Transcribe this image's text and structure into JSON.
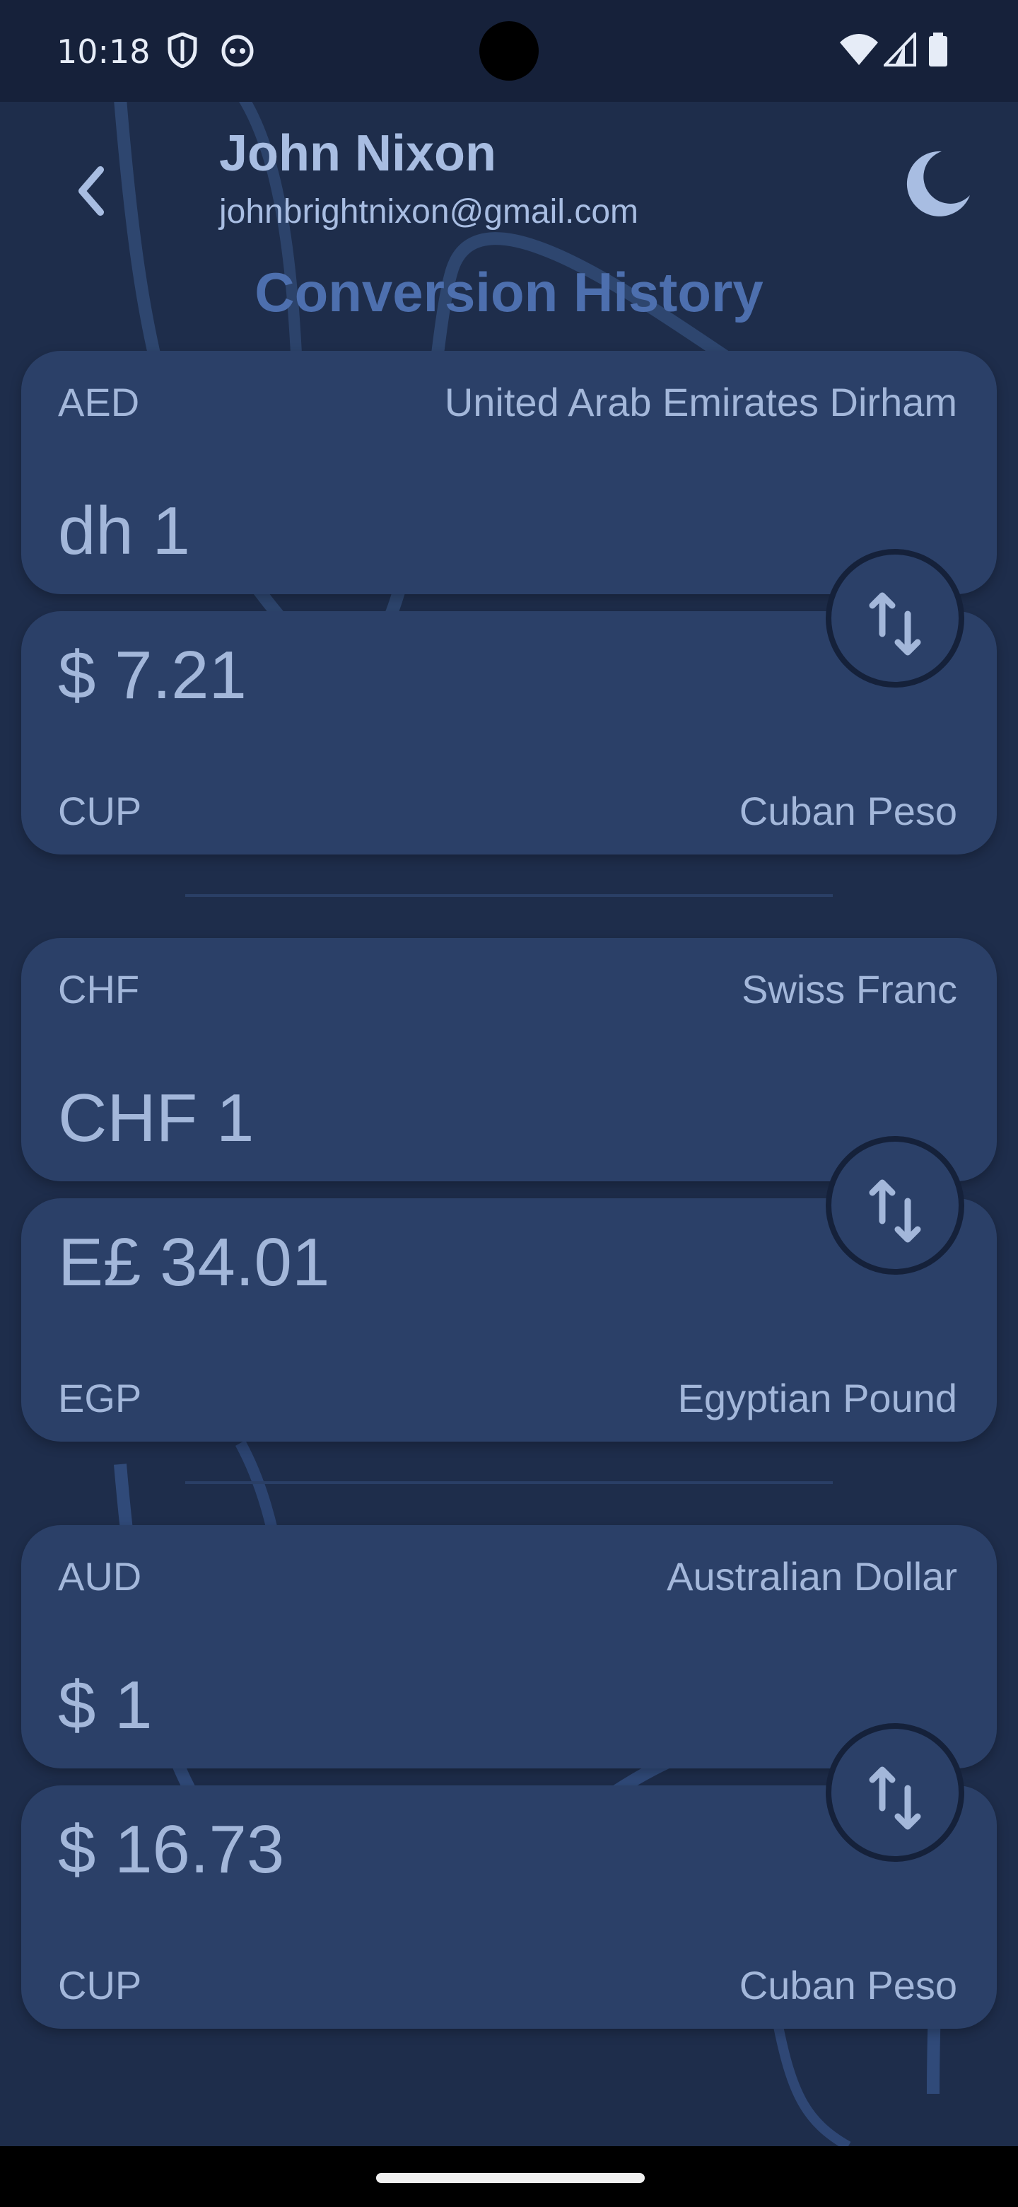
{
  "status_bar": {
    "time": "10:18",
    "icons": [
      "shield-icon",
      "cat-icon",
      "wifi-icon",
      "signal-icon",
      "battery-icon"
    ]
  },
  "header": {
    "user_name": "John Nixon",
    "user_email": "johnbrightnixon@gmail.com",
    "back_icon": "back-chevron-icon",
    "theme_icon": "moon-icon"
  },
  "title": "Conversion History",
  "conversions": [
    {
      "from": {
        "code": "AED",
        "name": "United Arab Emirates Dirham",
        "amount": "dh 1"
      },
      "to": {
        "code": "CUP",
        "name": "Cuban Peso",
        "amount": "$ 7.21"
      }
    },
    {
      "from": {
        "code": "CHF",
        "name": "Swiss Franc",
        "amount": "CHF 1"
      },
      "to": {
        "code": "EGP",
        "name": "Egyptian Pound",
        "amount": "E£ 34.01"
      }
    },
    {
      "from": {
        "code": "AUD",
        "name": "Australian Dollar",
        "amount": "$ 1"
      },
      "to": {
        "code": "CUP",
        "name": "Cuban Peso",
        "amount": "$ 16.73"
      }
    }
  ],
  "colors": {
    "background": "#1e2d4b",
    "card": "#2b4068",
    "text": "#a3b7da",
    "title": "#4d6fae"
  }
}
